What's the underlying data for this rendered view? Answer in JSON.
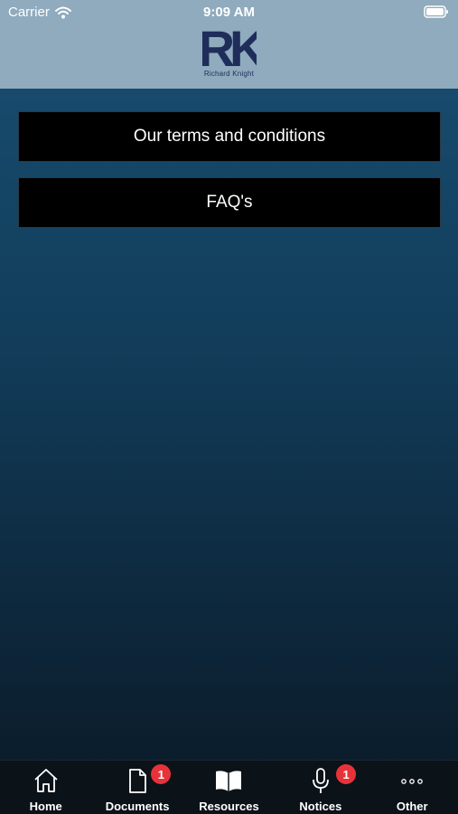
{
  "status_bar": {
    "carrier": "Carrier",
    "time": "9:09 AM"
  },
  "header": {
    "logo_letters": "RK",
    "logo_text": "Richard Knight",
    "background": "#8fabbd",
    "logo_color": "#1f2d5a"
  },
  "main": {
    "buttons": [
      {
        "label": "Our terms and conditions"
      },
      {
        "label": "FAQ's"
      }
    ]
  },
  "tabbar": {
    "badge_color": "#e8323a",
    "tabs": [
      {
        "label": "Home",
        "icon": "home-icon",
        "badge": null
      },
      {
        "label": "Documents",
        "icon": "document-icon",
        "badge": "1"
      },
      {
        "label": "Resources",
        "icon": "book-icon",
        "badge": null
      },
      {
        "label": "Notices",
        "icon": "microphone-icon",
        "badge": "1"
      },
      {
        "label": "Other",
        "icon": "more-icon",
        "badge": null
      }
    ]
  }
}
